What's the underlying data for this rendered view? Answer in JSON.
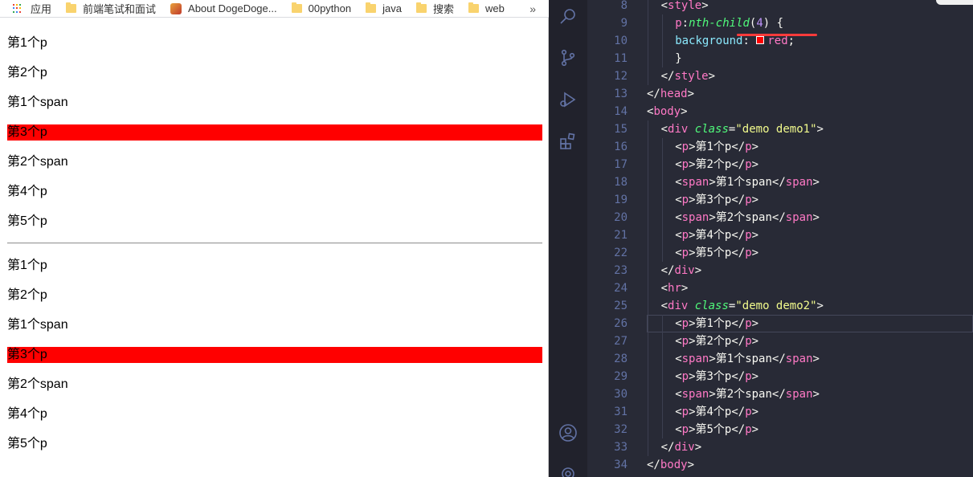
{
  "bookmarks": {
    "apps": "应用",
    "items": [
      "前端笔试和面试",
      "About DogeDoge...",
      "00python",
      "java",
      "搜索",
      "web"
    ],
    "more": "»"
  },
  "page": {
    "demo1": [
      "第1个p",
      "第2个p",
      "第1个span",
      "第3个p",
      "第2个span",
      "第4个p",
      "第5个p"
    ],
    "demo2": [
      "第1个p",
      "第2个p",
      "第1个span",
      "第3个p",
      "第2个span",
      "第4个p",
      "第5个p"
    ],
    "highlight_index": 3,
    "highlight_color": "#ff0000"
  },
  "editor": {
    "theme": {
      "background": "#282a36",
      "tag": "#ff79c6",
      "attr": "#50fa7b",
      "string": "#f1fa8c",
      "number": "#bd93f9",
      "property": "#8be9fd",
      "line_number": "#6272a4"
    },
    "active_line": 26,
    "lines": [
      {
        "n": "8",
        "indent": 1,
        "tokens": [
          [
            "punc",
            "<"
          ],
          [
            "tag",
            "style"
          ],
          [
            "punc",
            ">"
          ]
        ]
      },
      {
        "n": "9",
        "indent": 2,
        "tokens": [
          [
            "tag",
            "p"
          ],
          [
            "punc",
            ":"
          ],
          [
            "pseudo",
            "nth-child"
          ],
          [
            "punc",
            "("
          ],
          [
            "num",
            "4"
          ],
          [
            "punc",
            ") {"
          ]
        ]
      },
      {
        "n": "10",
        "indent": 2,
        "tokens": [
          [
            "prop",
            "background"
          ],
          [
            "punc",
            ": "
          ],
          [
            "swatch",
            ""
          ],
          [
            "val",
            "red"
          ],
          [
            "punc",
            ";"
          ]
        ]
      },
      {
        "n": "11",
        "indent": 2,
        "tokens": [
          [
            "punc",
            "}"
          ]
        ]
      },
      {
        "n": "12",
        "indent": 1,
        "tokens": [
          [
            "punc",
            "</"
          ],
          [
            "tag",
            "style"
          ],
          [
            "punc",
            ">"
          ]
        ]
      },
      {
        "n": "13",
        "indent": 0,
        "tokens": [
          [
            "punc",
            "</"
          ],
          [
            "tag",
            "head"
          ],
          [
            "punc",
            ">"
          ]
        ]
      },
      {
        "n": "14",
        "indent": 0,
        "tokens": [
          [
            "punc",
            "<"
          ],
          [
            "tag",
            "body"
          ],
          [
            "punc",
            ">"
          ]
        ]
      },
      {
        "n": "15",
        "indent": 1,
        "tokens": [
          [
            "punc",
            "<"
          ],
          [
            "tag",
            "div"
          ],
          [
            "punc",
            " "
          ],
          [
            "attr",
            "class"
          ],
          [
            "punc",
            "="
          ],
          [
            "str",
            "\"demo demo1\""
          ],
          [
            "punc",
            ">"
          ]
        ]
      },
      {
        "n": "16",
        "indent": 2,
        "tokens": [
          [
            "punc",
            "<"
          ],
          [
            "tag",
            "p"
          ],
          [
            "punc",
            ">第1个p</"
          ],
          [
            "tag",
            "p"
          ],
          [
            "punc",
            ">"
          ]
        ]
      },
      {
        "n": "17",
        "indent": 2,
        "tokens": [
          [
            "punc",
            "<"
          ],
          [
            "tag",
            "p"
          ],
          [
            "punc",
            ">第2个p</"
          ],
          [
            "tag",
            "p"
          ],
          [
            "punc",
            ">"
          ]
        ]
      },
      {
        "n": "18",
        "indent": 2,
        "tokens": [
          [
            "punc",
            "<"
          ],
          [
            "tag",
            "span"
          ],
          [
            "punc",
            ">第1个span</"
          ],
          [
            "tag",
            "span"
          ],
          [
            "punc",
            ">"
          ]
        ]
      },
      {
        "n": "19",
        "indent": 2,
        "tokens": [
          [
            "punc",
            "<"
          ],
          [
            "tag",
            "p"
          ],
          [
            "punc",
            ">第3个p</"
          ],
          [
            "tag",
            "p"
          ],
          [
            "punc",
            ">"
          ]
        ]
      },
      {
        "n": "20",
        "indent": 2,
        "tokens": [
          [
            "punc",
            "<"
          ],
          [
            "tag",
            "span"
          ],
          [
            "punc",
            ">第2个span</"
          ],
          [
            "tag",
            "span"
          ],
          [
            "punc",
            ">"
          ]
        ]
      },
      {
        "n": "21",
        "indent": 2,
        "tokens": [
          [
            "punc",
            "<"
          ],
          [
            "tag",
            "p"
          ],
          [
            "punc",
            ">第4个p</"
          ],
          [
            "tag",
            "p"
          ],
          [
            "punc",
            ">"
          ]
        ]
      },
      {
        "n": "22",
        "indent": 2,
        "tokens": [
          [
            "punc",
            "<"
          ],
          [
            "tag",
            "p"
          ],
          [
            "punc",
            ">第5个p</"
          ],
          [
            "tag",
            "p"
          ],
          [
            "punc",
            ">"
          ]
        ]
      },
      {
        "n": "23",
        "indent": 1,
        "tokens": [
          [
            "punc",
            "</"
          ],
          [
            "tag",
            "div"
          ],
          [
            "punc",
            ">"
          ]
        ]
      },
      {
        "n": "24",
        "indent": 1,
        "tokens": [
          [
            "punc",
            "<"
          ],
          [
            "tag",
            "hr"
          ],
          [
            "punc",
            ">"
          ]
        ]
      },
      {
        "n": "25",
        "indent": 1,
        "tokens": [
          [
            "punc",
            "<"
          ],
          [
            "tag",
            "div"
          ],
          [
            "punc",
            " "
          ],
          [
            "attr",
            "class"
          ],
          [
            "punc",
            "="
          ],
          [
            "str",
            "\"demo demo2\""
          ],
          [
            "punc",
            ">"
          ]
        ]
      },
      {
        "n": "26",
        "indent": 2,
        "tokens": [
          [
            "punc",
            "<"
          ],
          [
            "tag",
            "p"
          ],
          [
            "punc",
            ">第1个p</"
          ],
          [
            "tag",
            "p"
          ],
          [
            "punc",
            ">"
          ]
        ]
      },
      {
        "n": "27",
        "indent": 2,
        "tokens": [
          [
            "punc",
            "<"
          ],
          [
            "tag",
            "p"
          ],
          [
            "punc",
            ">第2个p</"
          ],
          [
            "tag",
            "p"
          ],
          [
            "punc",
            ">"
          ]
        ]
      },
      {
        "n": "28",
        "indent": 2,
        "tokens": [
          [
            "punc",
            "<"
          ],
          [
            "tag",
            "span"
          ],
          [
            "punc",
            ">第1个span</"
          ],
          [
            "tag",
            "span"
          ],
          [
            "punc",
            ">"
          ]
        ]
      },
      {
        "n": "29",
        "indent": 2,
        "tokens": [
          [
            "punc",
            "<"
          ],
          [
            "tag",
            "p"
          ],
          [
            "punc",
            ">第3个p</"
          ],
          [
            "tag",
            "p"
          ],
          [
            "punc",
            ">"
          ]
        ]
      },
      {
        "n": "30",
        "indent": 2,
        "tokens": [
          [
            "punc",
            "<"
          ],
          [
            "tag",
            "span"
          ],
          [
            "punc",
            ">第2个span</"
          ],
          [
            "tag",
            "span"
          ],
          [
            "punc",
            ">"
          ]
        ]
      },
      {
        "n": "31",
        "indent": 2,
        "tokens": [
          [
            "punc",
            "<"
          ],
          [
            "tag",
            "p"
          ],
          [
            "punc",
            ">第4个p</"
          ],
          [
            "tag",
            "p"
          ],
          [
            "punc",
            ">"
          ]
        ]
      },
      {
        "n": "32",
        "indent": 2,
        "tokens": [
          [
            "punc",
            "<"
          ],
          [
            "tag",
            "p"
          ],
          [
            "punc",
            ">第5个p</"
          ],
          [
            "tag",
            "p"
          ],
          [
            "punc",
            ">"
          ]
        ]
      },
      {
        "n": "33",
        "indent": 1,
        "tokens": [
          [
            "punc",
            "</"
          ],
          [
            "tag",
            "div"
          ],
          [
            "punc",
            ">"
          ]
        ]
      },
      {
        "n": "34",
        "indent": 0,
        "tokens": [
          [
            "punc",
            "</"
          ],
          [
            "tag",
            "body"
          ],
          [
            "punc",
            ">"
          ]
        ]
      }
    ]
  }
}
